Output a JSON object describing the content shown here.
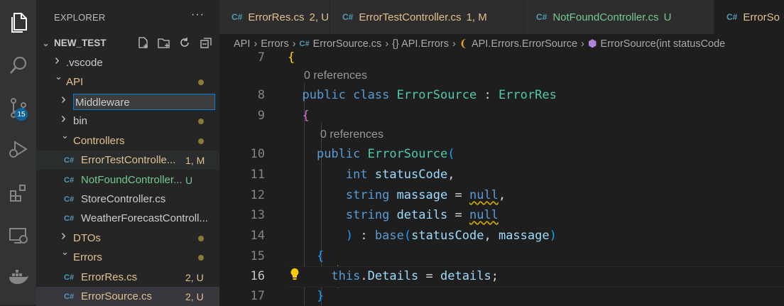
{
  "sidebar": {
    "title": "EXPLORER",
    "more": "···",
    "root": "NEW_TEST",
    "items": [
      {
        "label": ".vscode",
        "status": "",
        "dot": false,
        "type": "folder",
        "expanded": false,
        "level": 1
      },
      {
        "label": "API",
        "status": "",
        "dot": true,
        "type": "folder",
        "expanded": true,
        "level": 1,
        "color": "#e2c08d"
      },
      {
        "label": "Middleware",
        "status": "",
        "dot": false,
        "type": "folder",
        "expanded": false,
        "level": 2,
        "renaming": true
      },
      {
        "label": "bin",
        "status": "",
        "dot": true,
        "type": "folder",
        "expanded": false,
        "level": 2
      },
      {
        "label": "Controllers",
        "status": "",
        "dot": true,
        "type": "folder",
        "expanded": true,
        "level": 2,
        "color": "#e2c08d"
      },
      {
        "label": "ErrorTestControlle...",
        "status": "1, M",
        "dot": false,
        "type": "cs",
        "level": 3,
        "color": "#e2c08d"
      },
      {
        "label": "NotFoundController...",
        "status": "U",
        "dot": false,
        "type": "cs",
        "level": 3,
        "color": "#73c991"
      },
      {
        "label": "StoreController.cs",
        "status": "",
        "dot": false,
        "type": "cs",
        "level": 3
      },
      {
        "label": "WeatherForecastControll...",
        "status": "",
        "dot": false,
        "type": "cs",
        "level": 3
      },
      {
        "label": "DTOs",
        "status": "",
        "dot": true,
        "type": "folder",
        "expanded": false,
        "level": 2,
        "color": "#e2c08d"
      },
      {
        "label": "Errors",
        "status": "",
        "dot": true,
        "type": "folder",
        "expanded": true,
        "level": 2,
        "color": "#e2c08d"
      },
      {
        "label": "ErrorRes.cs",
        "status": "2, U",
        "dot": false,
        "type": "cs",
        "level": 3,
        "color": "#e2c08d"
      },
      {
        "label": "ErrorSource.cs",
        "status": "2, U",
        "dot": false,
        "type": "cs",
        "level": 3,
        "color": "#e2c08d",
        "selected": true
      }
    ]
  },
  "tabs": [
    {
      "label": "ErrorRes.cs",
      "status": "2, U",
      "color": "#e2c08d"
    },
    {
      "label": "ErrorTestController.cs",
      "status": "1, M",
      "color": "#e2c08d"
    },
    {
      "label": "NotFoundController.cs",
      "status": "U",
      "color": "#73c991"
    },
    {
      "label": "ErrorSo",
      "status": "",
      "color": "#e2c08d"
    }
  ],
  "breadcrumb": [
    "API",
    "Errors",
    "ErrorSource.cs",
    "{} API.Errors",
    "API.Errors.ErrorSource",
    "ErrorSource(int statusCode"
  ],
  "editor": {
    "line_numbers": [
      "7",
      "8",
      "9",
      "10",
      "11",
      "12",
      "13",
      "14",
      "15",
      "16",
      "17"
    ],
    "references_label": "0 references",
    "current_line": "16"
  },
  "activity": {
    "icons": [
      "files-icon",
      "search-icon",
      "source-control-icon",
      "run-debug-icon",
      "extensions-icon",
      "remote-explorer-icon",
      "docker-icon"
    ],
    "scm_badge": "15"
  },
  "colors": {
    "accent": "#0e639c",
    "modified": "#e2c08d",
    "untracked": "#73c991"
  }
}
